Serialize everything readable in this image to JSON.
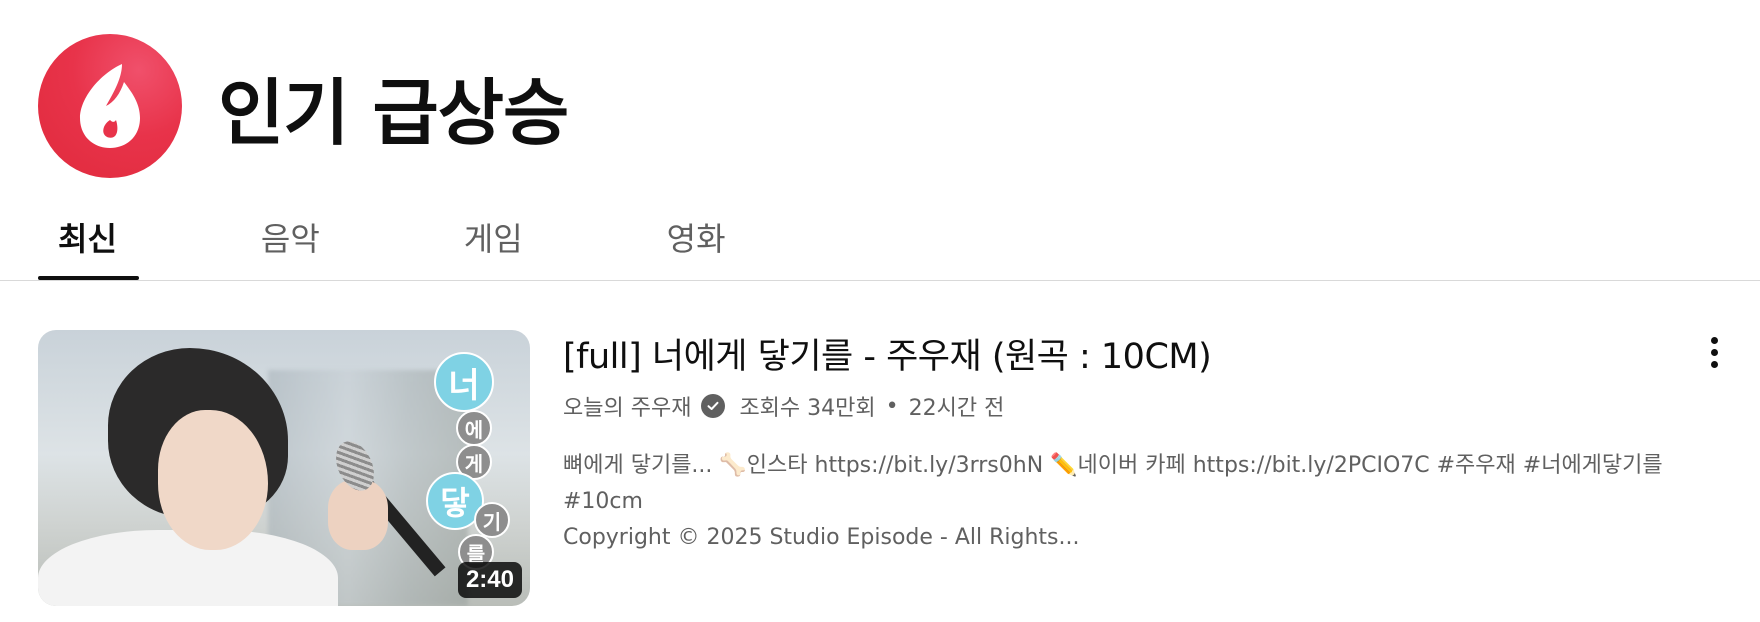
{
  "header": {
    "title": "인기 급상승",
    "logo_color": "#e8334a"
  },
  "tabs": [
    {
      "label": "최신",
      "active": true
    },
    {
      "label": "음악",
      "active": false
    },
    {
      "label": "게임",
      "active": false
    },
    {
      "label": "영화",
      "active": false
    }
  ],
  "video": {
    "title": "[full] 너에게 닿기를 - 주우재 (원곡 : 10CM)",
    "channel": "오늘의 주우재",
    "views": "조회수 34만회",
    "separator": "•",
    "age": "22시간 전",
    "description_line1": "뼈에게 닿기를... 🦴인스타 https://bit.ly/3rrs0hN ✏️네이버 카페 https://bit.ly/2PCIO7C #주우재 #너에게닿기를 #10cm",
    "description_line2": "Copyright © 2025 Studio Episode - All Rights...",
    "duration": "2:40",
    "thumbnail_text": [
      "너",
      "에",
      "게",
      "닿",
      "기",
      "를"
    ]
  }
}
